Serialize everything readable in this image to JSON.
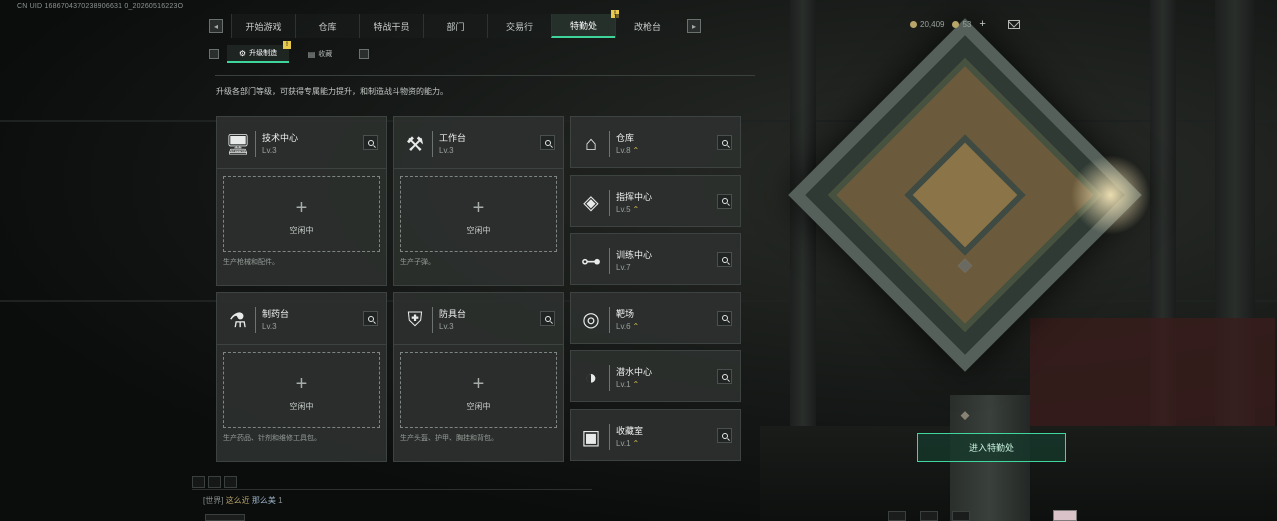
{
  "uid_text": "CN UID 1686704370238906631 0_20260516223O",
  "nav": {
    "tabs": [
      "开始游戏",
      "仓库",
      "特战干员",
      "部门",
      "交易行",
      "特勤处",
      "改枪台"
    ],
    "active": "特勤处",
    "badge_text": "!"
  },
  "subnav": {
    "tabs": [
      {
        "label": "升级制造",
        "active": true,
        "icon": "gear-icon"
      },
      {
        "label": "收藏",
        "active": false,
        "icon": "collection-icon"
      }
    ],
    "badge_text": "!"
  },
  "currency": [
    {
      "value": "20,409",
      "icon": "coin-icon"
    },
    {
      "value": "53",
      "icon": "coin-icon"
    }
  ],
  "plus_label": "+",
  "description": "升级各部门等级，可获得专属能力提升，和制造战斗物资的能力。",
  "production": {
    "slot_idle_label": "空闲中",
    "slot_plus": "+",
    "cards": [
      {
        "name": "技术中心",
        "level": "Lv.3",
        "icon": "monitor-icon",
        "glyph": "🖥",
        "desc": "生产枪械和配件。"
      },
      {
        "name": "工作台",
        "level": "Lv.3",
        "icon": "tools-icon",
        "glyph": "⚒",
        "desc": "生产子弹。"
      },
      {
        "name": "制药台",
        "level": "Lv.3",
        "icon": "microscope-icon",
        "glyph": "⚗",
        "desc": "生产药品、针剂和维修工具包。"
      },
      {
        "name": "防具台",
        "level": "Lv.3",
        "icon": "armor-icon",
        "glyph": "⛨",
        "desc": "生产头盔、护甲、胸挂和背包。"
      }
    ]
  },
  "facilities": [
    {
      "name": "仓库",
      "level": "Lv.8",
      "upgradable": true,
      "icon": "warehouse-icon",
      "glyph": "⌂"
    },
    {
      "name": "指挥中心",
      "level": "Lv.5",
      "upgradable": true,
      "icon": "command-icon",
      "glyph": "◈"
    },
    {
      "name": "训练中心",
      "level": "Lv.7",
      "upgradable": false,
      "icon": "dumbbell-icon",
      "glyph": "⊶"
    },
    {
      "name": "靶场",
      "level": "Lv.6",
      "upgradable": true,
      "icon": "target-icon",
      "glyph": "◎"
    },
    {
      "name": "潜水中心",
      "level": "Lv.1",
      "upgradable": true,
      "icon": "diving-mask-icon",
      "glyph": "◑"
    },
    {
      "name": "收藏室",
      "level": "Lv.1",
      "upgradable": true,
      "icon": "display-case-icon",
      "glyph": "▣"
    }
  ],
  "upgrade_glyph": "⌃",
  "enter_button": "进入特勤处",
  "chat": {
    "channel": "[世界]",
    "user": "这么近",
    "message": "那么美",
    "count": "1"
  },
  "colors": {
    "accent": "#3ed49a",
    "badge": "#e9c94b",
    "upgrade": "#e2c257"
  }
}
